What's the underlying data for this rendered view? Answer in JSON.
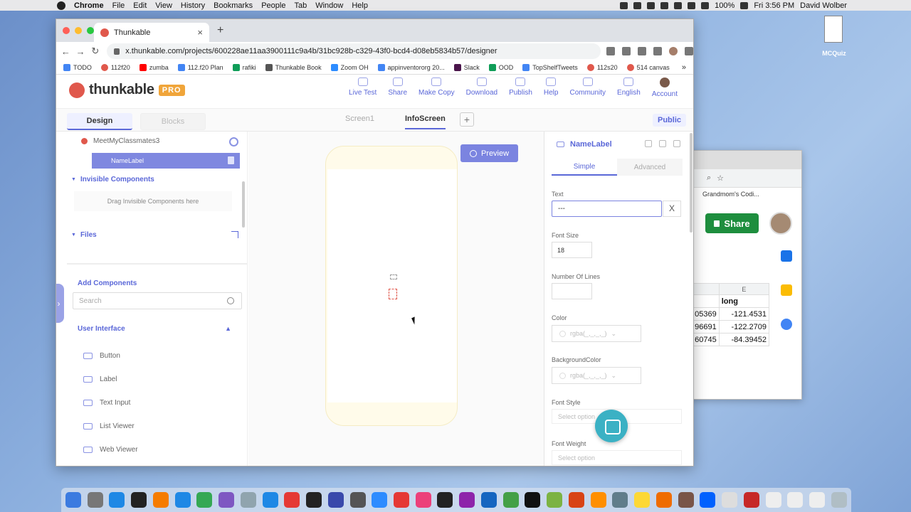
{
  "menubar": {
    "app": "Chrome",
    "items": [
      "File",
      "Edit",
      "View",
      "History",
      "Bookmarks",
      "People",
      "Tab",
      "Window",
      "Help"
    ],
    "battery": "100%",
    "clock": "Fri 3:56 PM",
    "user": "David Wolber"
  },
  "desktop": {
    "file_label": "MCQuiz"
  },
  "background_window": {
    "bookmark": "Grandmom's Codi...",
    "share_label": "Share",
    "columns": [
      "E"
    ],
    "header": "long",
    "rows": [
      [
        "05369",
        "-121.4531"
      ],
      [
        "96691",
        "-122.2709"
      ],
      [
        "60745",
        "-84.39452"
      ]
    ]
  },
  "browser": {
    "tab_title": "Thunkable",
    "url": "x.thunkable.com/projects/600228ae11aa3900111c9a4b/31bc928b-c329-43f0-bcd4-d08eb5834b57/designer",
    "bookmarks": [
      "TODO",
      "112f20",
      "zumba",
      "112.f20 Plan",
      "rafiki",
      "Thunkable Book",
      "Zoom OH",
      "appinventororg 20...",
      "Slack",
      "OOD",
      "TopShelfTweets",
      "112s20",
      "514 canvas"
    ]
  },
  "app": {
    "brand": "thunkable",
    "badge": "PRO",
    "nav": [
      "Live Test",
      "Share",
      "Make Copy",
      "Download",
      "Publish",
      "Help",
      "Community",
      "English",
      "Account"
    ],
    "tabs": {
      "design": "Design",
      "blocks": "Blocks"
    },
    "screens": [
      "Screen1",
      "InfoScreen"
    ],
    "active_screen": "InfoScreen",
    "public_label": "Public"
  },
  "left": {
    "project": "MeetMyClassmates3",
    "selected": "NameLabel",
    "invisible_title": "Invisible Components",
    "invisible_drop": "Drag Invisible Components here",
    "files_title": "Files",
    "add_components": "Add Components",
    "search_placeholder": "Search",
    "ui_section": "User Interface",
    "components": [
      "Button",
      "Label",
      "Text Input",
      "List Viewer",
      "Web Viewer"
    ]
  },
  "canvas": {
    "preview_label": "Preview"
  },
  "props": {
    "component": "NameLabel",
    "tab_simple": "Simple",
    "tab_advanced": "Advanced",
    "text_label": "Text",
    "text_value": "---",
    "clear": "X",
    "font_size_label": "Font Size",
    "font_size_value": "18",
    "lines_label": "Number Of Lines",
    "lines_value": "",
    "color_label": "Color",
    "color_value": "rgba(_,_,_,_)",
    "bg_label": "BackgroundColor",
    "bg_value": "rgba(_,_,_,_)",
    "style_label": "Font Style",
    "style_placeholder": "Select option",
    "weight_label": "Font Weight",
    "weight_placeholder": "Select option"
  },
  "colors": {
    "accent": "#5a67d8",
    "brand_red": "#e0584c",
    "pro": "#f0a53a",
    "share_green": "#1e8e3e"
  }
}
